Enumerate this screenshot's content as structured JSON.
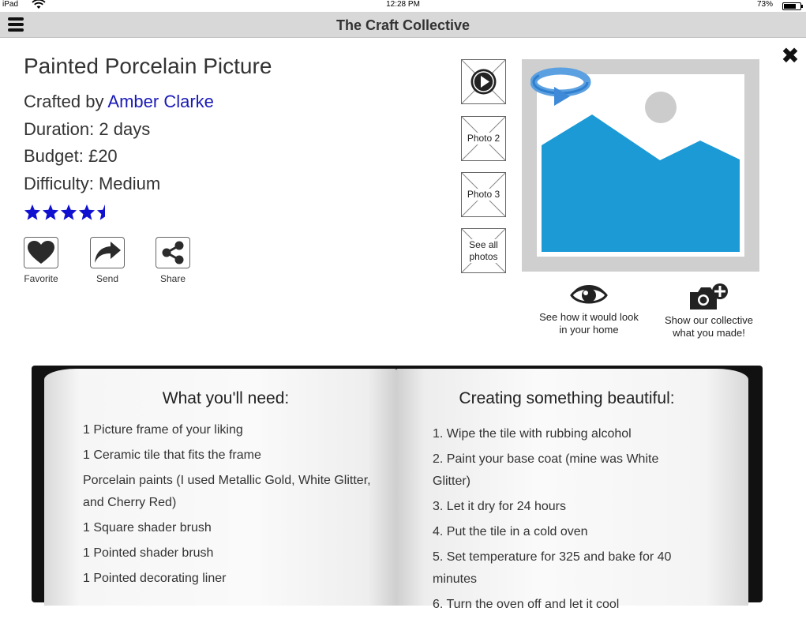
{
  "status_bar": {
    "carrier": "iPad",
    "time": "12:28 PM",
    "battery_pct": "73%",
    "battery_level": 0.73
  },
  "nav": {
    "title": "The Craft Collective"
  },
  "craft": {
    "title": "Painted Porcelain Picture",
    "crafted_by_prefix": "Crafted by",
    "author": "Amber Clarke",
    "duration": "Duration: 2 days",
    "budget": "Budget: £20",
    "difficulty": "Difficulty: Medium",
    "rating": 4.5,
    "rating_max": 5,
    "star_color": "#1010d0"
  },
  "actions": [
    {
      "label": "Favorite",
      "icon": "heart-icon"
    },
    {
      "label": "Send",
      "icon": "share-arrow-icon"
    },
    {
      "label": "Share",
      "icon": "share-nodes-icon"
    }
  ],
  "thumbnails": [
    {
      "label": "",
      "icon": "play-icon"
    },
    {
      "label": "Photo 2"
    },
    {
      "label": "Photo 3"
    },
    {
      "label": "See all photos"
    }
  ],
  "main_image": {
    "icon": "image-placeholder-icon",
    "rotate_icon": "rotate-icon",
    "sky_color": "#ffffff",
    "mountain_color": "#1b9ad6",
    "sun_color": "#cccccc"
  },
  "features": [
    {
      "label": "See how it would look in your home",
      "icon": "eye-icon"
    },
    {
      "label": "Show our collective what you made!",
      "icon": "camera-plus-icon"
    }
  ],
  "book": {
    "left_title": "What you'll need:",
    "materials": [
      "1 Picture frame of your liking",
      "1 Ceramic tile that fits the frame",
      "Porcelain paints (I used Metallic Gold, White Glitter, and Cherry Red)",
      "1 Square shader brush",
      "1 Pointed shader brush",
      "1 Pointed decorating liner"
    ],
    "right_title": "Creating something beautiful:",
    "steps": [
      "1. Wipe the tile with rubbing alcohol",
      "2. Paint your base coat (mine was White Glitter)",
      "3. Let it dry for 24 hours",
      "4. Put the tile in a cold oven",
      "5. Set temperature for 325 and bake for 40 minutes",
      "6. Turn the oven off and let it cool"
    ]
  }
}
